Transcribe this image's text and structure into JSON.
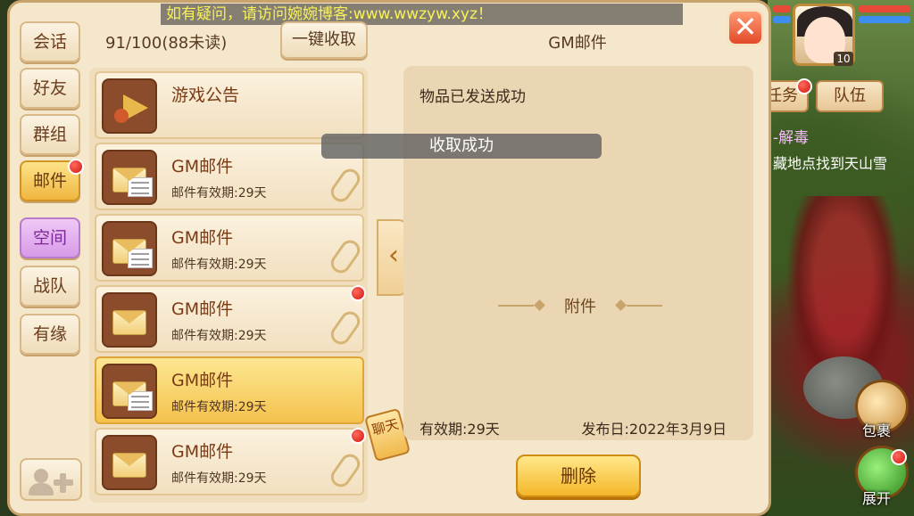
{
  "banner": "如有疑问，请访问婉婉博客:www.wwzyw.xyz！",
  "nav": [
    {
      "label": "会话"
    },
    {
      "label": "好友"
    },
    {
      "label": "群组"
    },
    {
      "label": "邮件"
    },
    {
      "label": "空间"
    },
    {
      "label": "战队"
    },
    {
      "label": "有缘"
    }
  ],
  "mail": {
    "count": "91/100(88未读)",
    "collect_all": "一键收取",
    "items": [
      {
        "title": "游戏公告",
        "sub": ""
      },
      {
        "title": "GM邮件",
        "sub": "邮件有效期:29天"
      },
      {
        "title": "GM邮件",
        "sub": "邮件有效期:29天"
      },
      {
        "title": "GM邮件",
        "sub": "邮件有效期:29天"
      },
      {
        "title": "GM邮件",
        "sub": "邮件有效期:29天"
      },
      {
        "title": "GM邮件",
        "sub": "邮件有效期:29天"
      }
    ]
  },
  "toast": "收取成功",
  "chat_tag": "聊天",
  "detail": {
    "title": "GM邮件",
    "message": "物品已发送成功",
    "attach": "附件",
    "validity": "有效期:29天",
    "publish": "发布日:2022年3月9日",
    "delete": "删除"
  },
  "close": "✕",
  "hud": {
    "level": "10",
    "tab_task": "任务",
    "tab_team": "队伍",
    "quest_title": "-解毒",
    "quest_desc": "藏地点找到天山雪",
    "bag": "包裹",
    "expand": "展开"
  }
}
